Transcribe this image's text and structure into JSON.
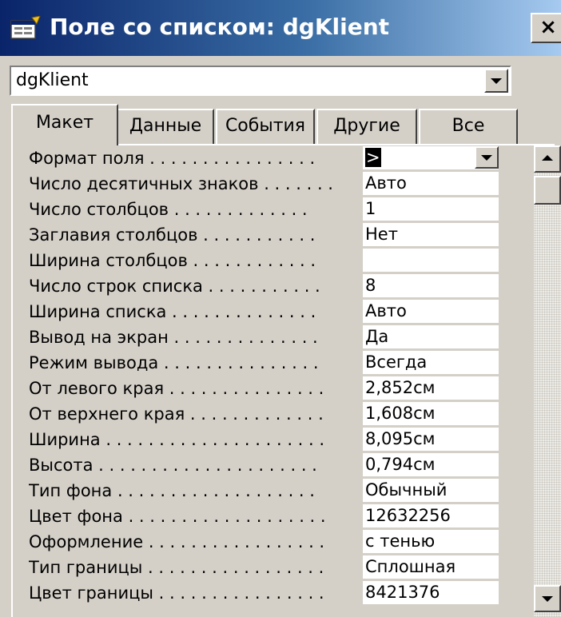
{
  "window": {
    "title": "Поле со списком: dgKlient",
    "close_label": "×",
    "icon": "properties-form-icon"
  },
  "object_selector": {
    "value": "dgKlient"
  },
  "tabs": [
    {
      "label": "Макет",
      "active": true
    },
    {
      "label": "Данные",
      "active": false
    },
    {
      "label": "События",
      "active": false
    },
    {
      "label": "Другие",
      "active": false
    },
    {
      "label": "Все",
      "active": false
    }
  ],
  "properties": [
    {
      "label": "Формат поля . . . . . . . . . . . . . . . .",
      "value": ">"
    },
    {
      "label": "Число десятичных знаков . . . . . . .",
      "value": "Авто"
    },
    {
      "label": "Число столбцов . . . . . . . . . . . . .",
      "value": "1"
    },
    {
      "label": "Заглавия столбцов . . . . . . . . . . .",
      "value": "Нет"
    },
    {
      "label": "Ширина столбцов . . . . . . . . . . . .",
      "value": ""
    },
    {
      "label": "Число строк списка . . . . . . . . . . .",
      "value": "8"
    },
    {
      "label": "Ширина списка . . . . . . . . . . . . . .",
      "value": "Авто"
    },
    {
      "label": "Вывод на экран . . . . . . . . . . . . . .",
      "value": "Да"
    },
    {
      "label": "Режим вывода . . . . . . . . . . . . . . .",
      "value": "Всегда"
    },
    {
      "label": "От левого края . . . . . . . . . . . . . . .",
      "value": "2,852см"
    },
    {
      "label": "От верхнего края . . . . . . . . . . . . .",
      "value": "1,608см"
    },
    {
      "label": "Ширина . . . . . . . . . . . . . . . . . . . . .",
      "value": "8,095см"
    },
    {
      "label": "Высота . . . . . . . . . . . . . . . . . . . . .",
      "value": "0,794см"
    },
    {
      "label": "Тип фона . . . . . . . . . . . . . . . . . . .",
      "value": "Обычный"
    },
    {
      "label": "Цвет фона . . . . . . . . . . . . . . . . . . .",
      "value": "12632256"
    },
    {
      "label": "Оформление . . . . . . . . . . . . . . . . .",
      "value": "с тенью"
    },
    {
      "label": "Тип границы . . . . . . . . . . . . . . . . .",
      "value": "Сплошная"
    },
    {
      "label": "Цвет границы . . . . . . . . . . . . . . . .",
      "value": "8421376"
    }
  ],
  "colors": {
    "title_bar_start": "#0a246a",
    "title_bar_end": "#a6caf0",
    "face": "#d4d0c8"
  }
}
